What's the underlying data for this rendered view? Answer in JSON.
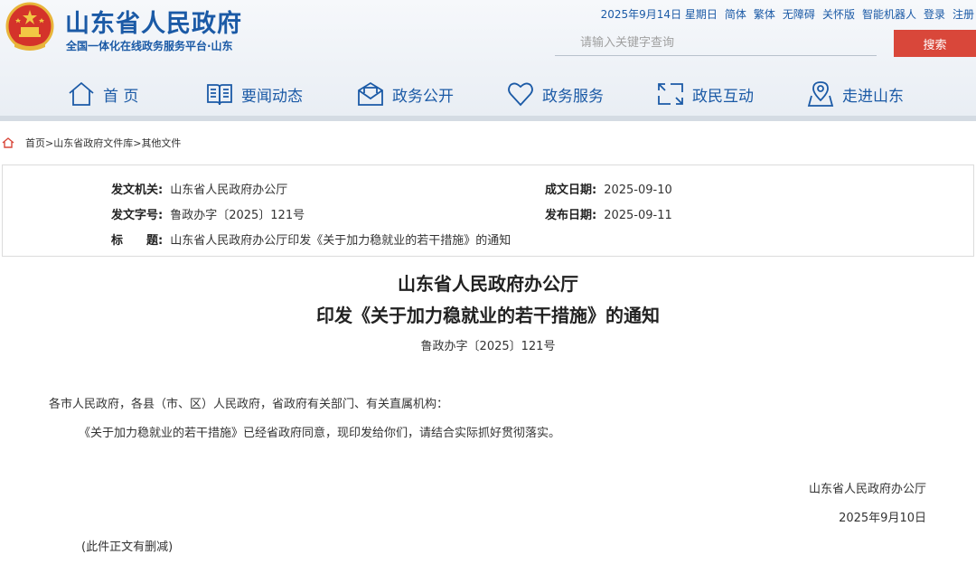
{
  "header": {
    "site_title": "山东省人民政府",
    "site_subtitle": "全国一体化在线政务服务平台·山东",
    "topbar": [
      "2025年9月14日 星期日",
      "简体",
      "繁体",
      "无障碍",
      "关怀版",
      "智能机器人",
      "登录",
      "注册"
    ],
    "search": {
      "placeholder": "请输入关键字查询",
      "button_label": "搜索"
    },
    "accent_color": "#1b5aa6",
    "search_button_color": "#d9473a"
  },
  "nav": {
    "items": [
      {
        "label": "首 页",
        "icon": "home-icon"
      },
      {
        "label": "要闻动态",
        "icon": "book-icon"
      },
      {
        "label": "政务公开",
        "icon": "envelope-icon"
      },
      {
        "label": "政务服务",
        "icon": "heart-icon"
      },
      {
        "label": "政民互动",
        "icon": "interaction-icon"
      },
      {
        "label": "走进山东",
        "icon": "map-pin-icon"
      }
    ]
  },
  "breadcrumb": {
    "items": [
      "首页",
      "山东省政府文件库",
      "其他文件"
    ],
    "separator": ">"
  },
  "info": {
    "issuer_label": "发文机关:",
    "issuer": "山东省人民政府办公厅",
    "doc_number_label": "发文字号:",
    "doc_number": "鲁政办字〔2025〕121号",
    "title_label": "标　　题:",
    "title": "山东省人民政府办公厅印发《关于加力稳就业的若干措施》的通知",
    "written_date_label": "成文日期:",
    "written_date": "2025-09-10",
    "publish_date_label": "发布日期:",
    "publish_date": "2025-09-11"
  },
  "article": {
    "title_line1": "山东省人民政府办公厅",
    "title_line2": "印发《关于加力稳就业的若干措施》的通知",
    "doc_number": "鲁政办字〔2025〕121号",
    "salutation": "各市人民政府，各县（市、区）人民政府，省政府有关部门、有关直属机构：",
    "body": "《关于加力稳就业的若干措施》已经省政府同意，现印发给你们，请结合实际抓好贯彻落实。",
    "signature": "山东省人民政府办公厅",
    "date": "2025年9月10日",
    "note": "(此件正文有删减)"
  }
}
